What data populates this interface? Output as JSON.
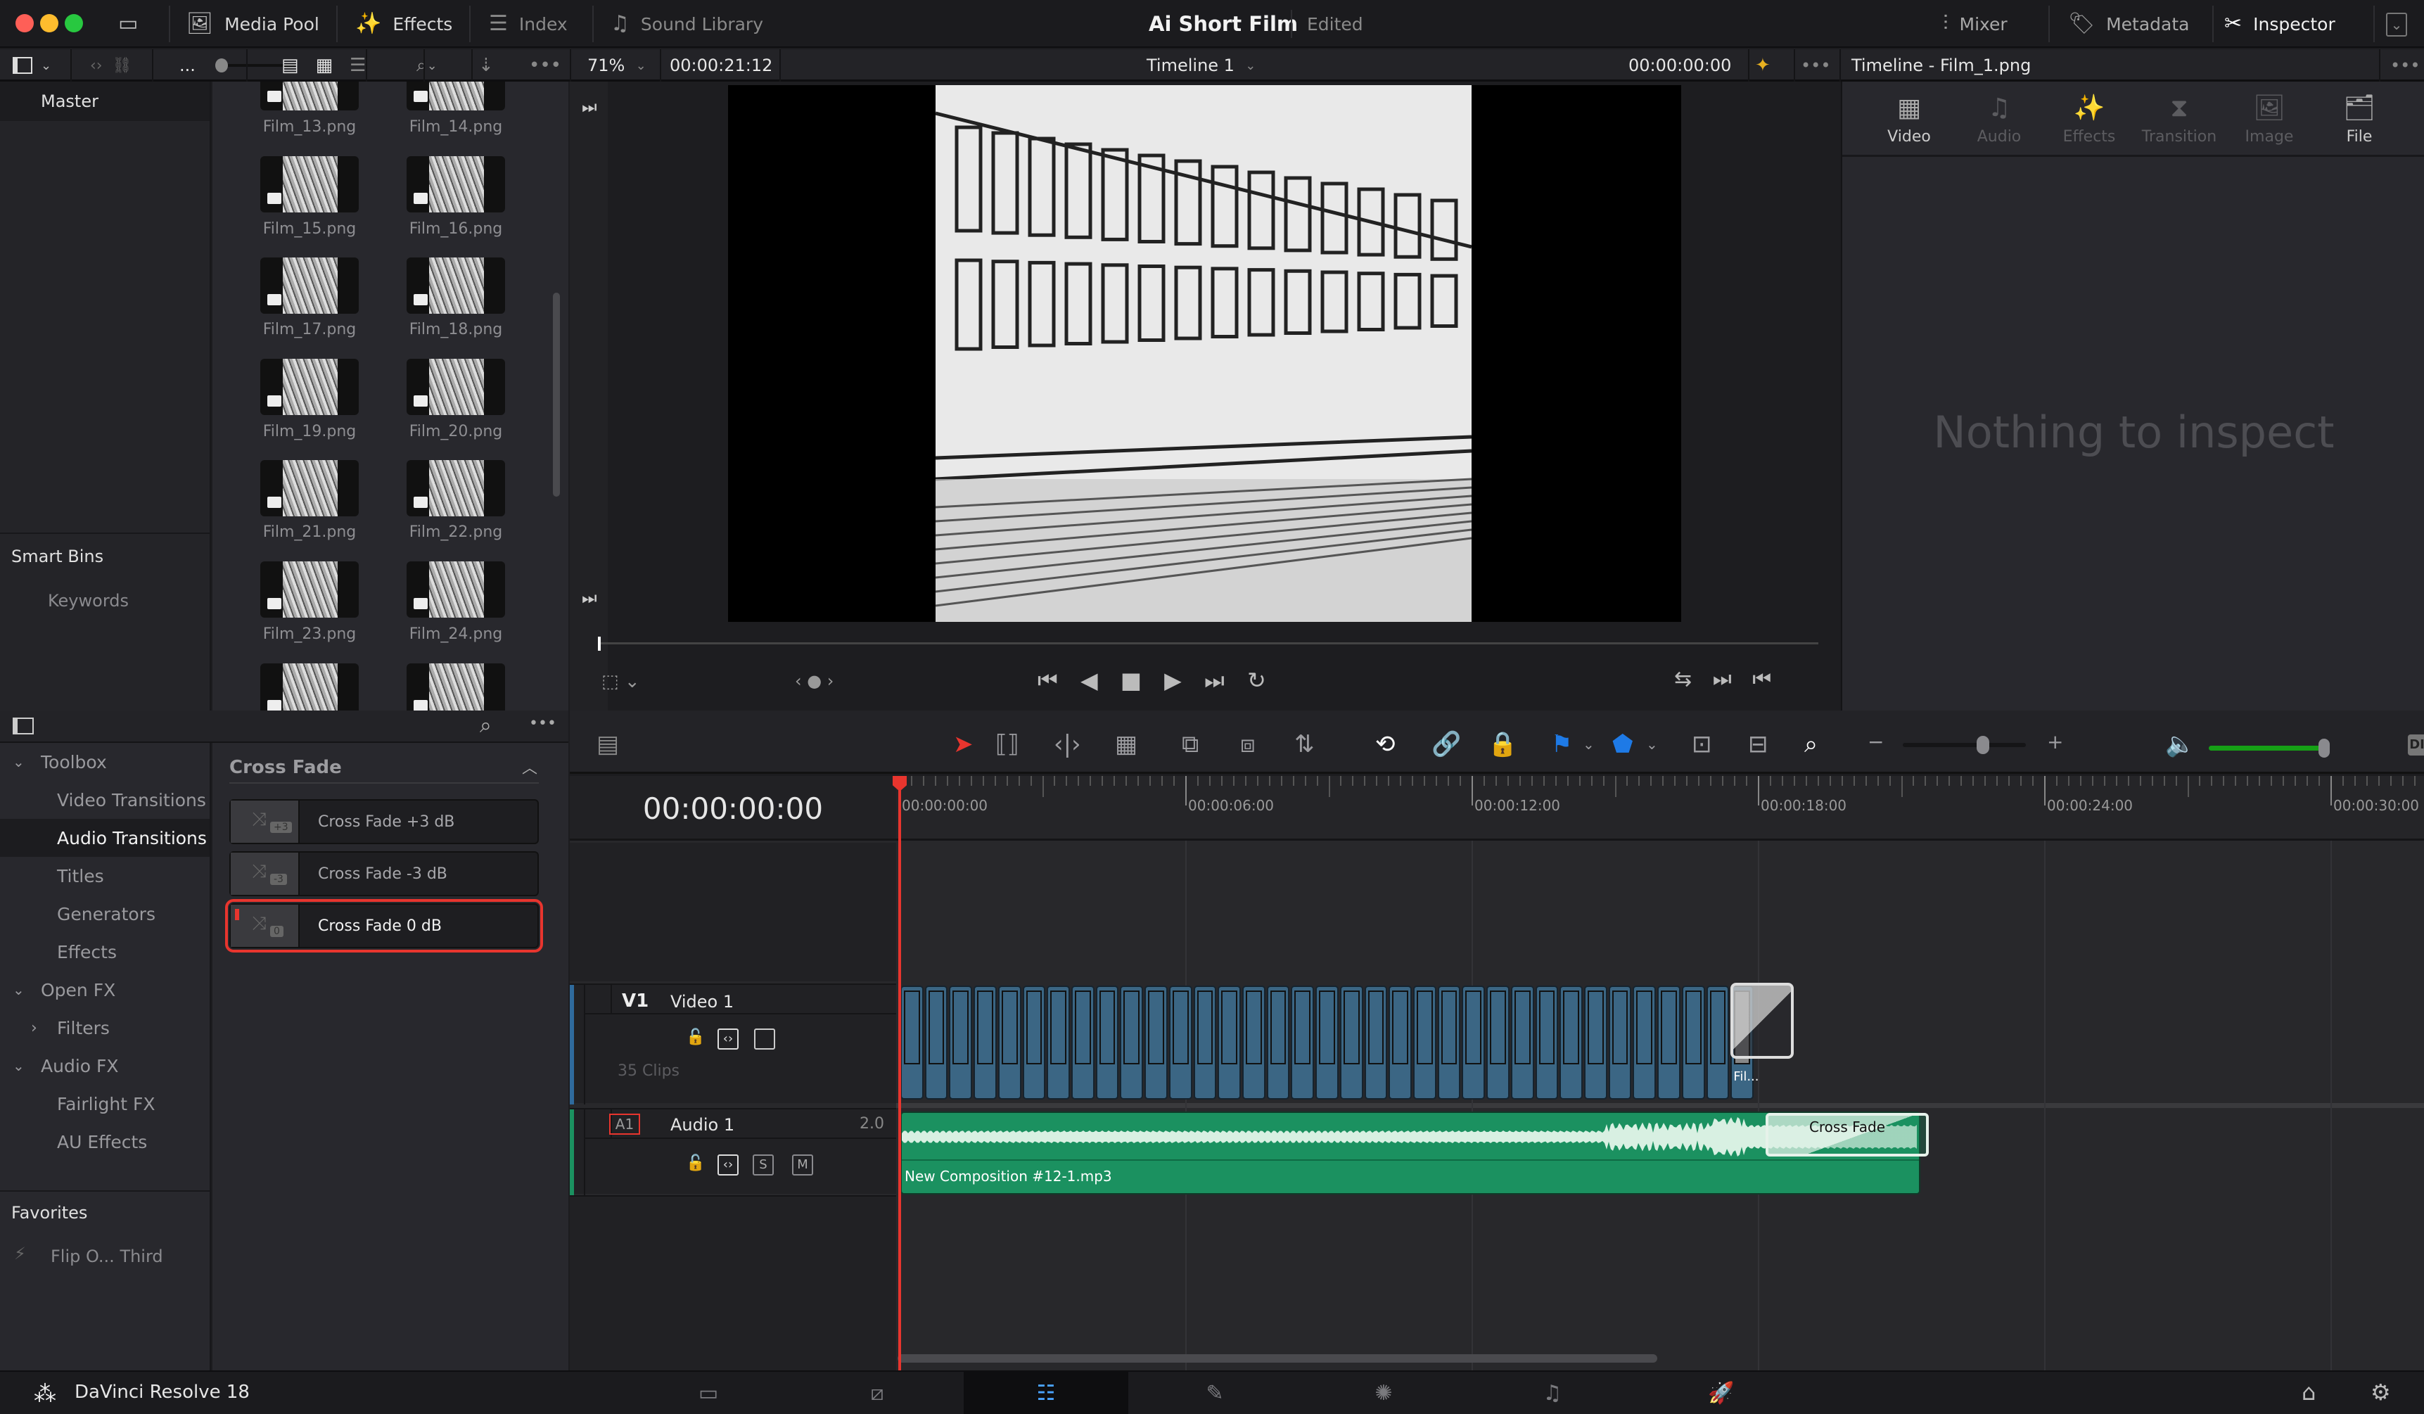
{
  "window": {
    "title": "Ai Short Film",
    "status": "Edited"
  },
  "topbar": {
    "left": [
      {
        "label": "Media Pool",
        "icon": "media-pool-icon"
      },
      {
        "label": "Effects",
        "icon": "effects-wand-icon"
      },
      {
        "label": "Index",
        "icon": "index-list-icon"
      },
      {
        "label": "Sound Library",
        "icon": "sound-library-icon"
      }
    ],
    "right": [
      {
        "label": "Mixer",
        "icon": "mixer-icon"
      },
      {
        "label": "Metadata",
        "icon": "metadata-icon"
      },
      {
        "label": "Inspector",
        "icon": "inspector-icon"
      }
    ]
  },
  "toolbar": {
    "ellipsis": "...",
    "zoom": "71%",
    "source_timecode": "00:00:21:12",
    "timeline_name": "Timeline 1",
    "record_timecode": "00:00:00:00"
  },
  "bins": {
    "master": "Master",
    "smart_bins": "Smart Bins",
    "keywords": "Keywords"
  },
  "media": [
    "Film_13.png",
    "Film_14.png",
    "Film_15.png",
    "Film_16.png",
    "Film_17.png",
    "Film_18.png",
    "Film_19.png",
    "Film_20.png",
    "Film_21.png",
    "Film_22.png",
    "Film_23.png",
    "Film_24.png"
  ],
  "inspector": {
    "title": "Timeline - Film_1.png",
    "tabs": [
      {
        "label": "Video",
        "active": true
      },
      {
        "label": "Audio",
        "active": false
      },
      {
        "label": "Effects",
        "active": false
      },
      {
        "label": "Transition",
        "active": false
      },
      {
        "label": "Image",
        "active": false
      },
      {
        "label": "File",
        "active": true
      }
    ],
    "empty": "Nothing to inspect"
  },
  "effects": {
    "tree": [
      {
        "label": "Toolbox",
        "level": 0,
        "expanded": true
      },
      {
        "label": "Video Transitions",
        "level": 1
      },
      {
        "label": "Audio Transitions",
        "level": 1,
        "selected": true
      },
      {
        "label": "Titles",
        "level": 1
      },
      {
        "label": "Generators",
        "level": 1
      },
      {
        "label": "Effects",
        "level": 1
      },
      {
        "label": "Open FX",
        "level": 0,
        "expanded": true
      },
      {
        "label": "Filters",
        "level": 1,
        "collapsed": true
      },
      {
        "label": "Audio FX",
        "level": 0,
        "expanded": true
      },
      {
        "label": "Fairlight FX",
        "level": 1
      },
      {
        "label": "AU Effects",
        "level": 1
      }
    ],
    "section": "Cross Fade",
    "items": [
      {
        "label": "Cross Fade +3 dB",
        "badge": "+3"
      },
      {
        "label": "Cross Fade -3 dB",
        "badge": "-3"
      },
      {
        "label": "Cross Fade 0 dB",
        "badge": "0",
        "selected": true
      }
    ],
    "favorites": "Favorites",
    "favorite_item": "Flip O... Third"
  },
  "timeline": {
    "timecode": "00:00:00:00",
    "ruler": [
      "00:00:00:00",
      "00:00:06:00",
      "00:00:12:00",
      "00:00:18:00",
      "00:00:24:00",
      "00:00:30:00"
    ],
    "video_track": {
      "id": "V1",
      "name": "Video 1",
      "clip_count": "35 Clips",
      "clips": 35,
      "last_clip_label": "Fil..."
    },
    "audio_track": {
      "id": "A1",
      "name": "Audio 1",
      "channels": "2.0",
      "clip": "New Composition #12-1.mp3",
      "transition": "Cross Fade",
      "solo": "S",
      "mute": "M"
    },
    "dim": "DIM",
    "volume_level": 1.0,
    "zoom_level": 0.65
  },
  "colors": {
    "playhead": "#e8352e",
    "video_clip": "#3b6684",
    "audio_clip": "#1b9160",
    "selection": "#e8352e",
    "volume": "#16a016"
  },
  "app": {
    "name": "DaVinci Resolve 18"
  }
}
